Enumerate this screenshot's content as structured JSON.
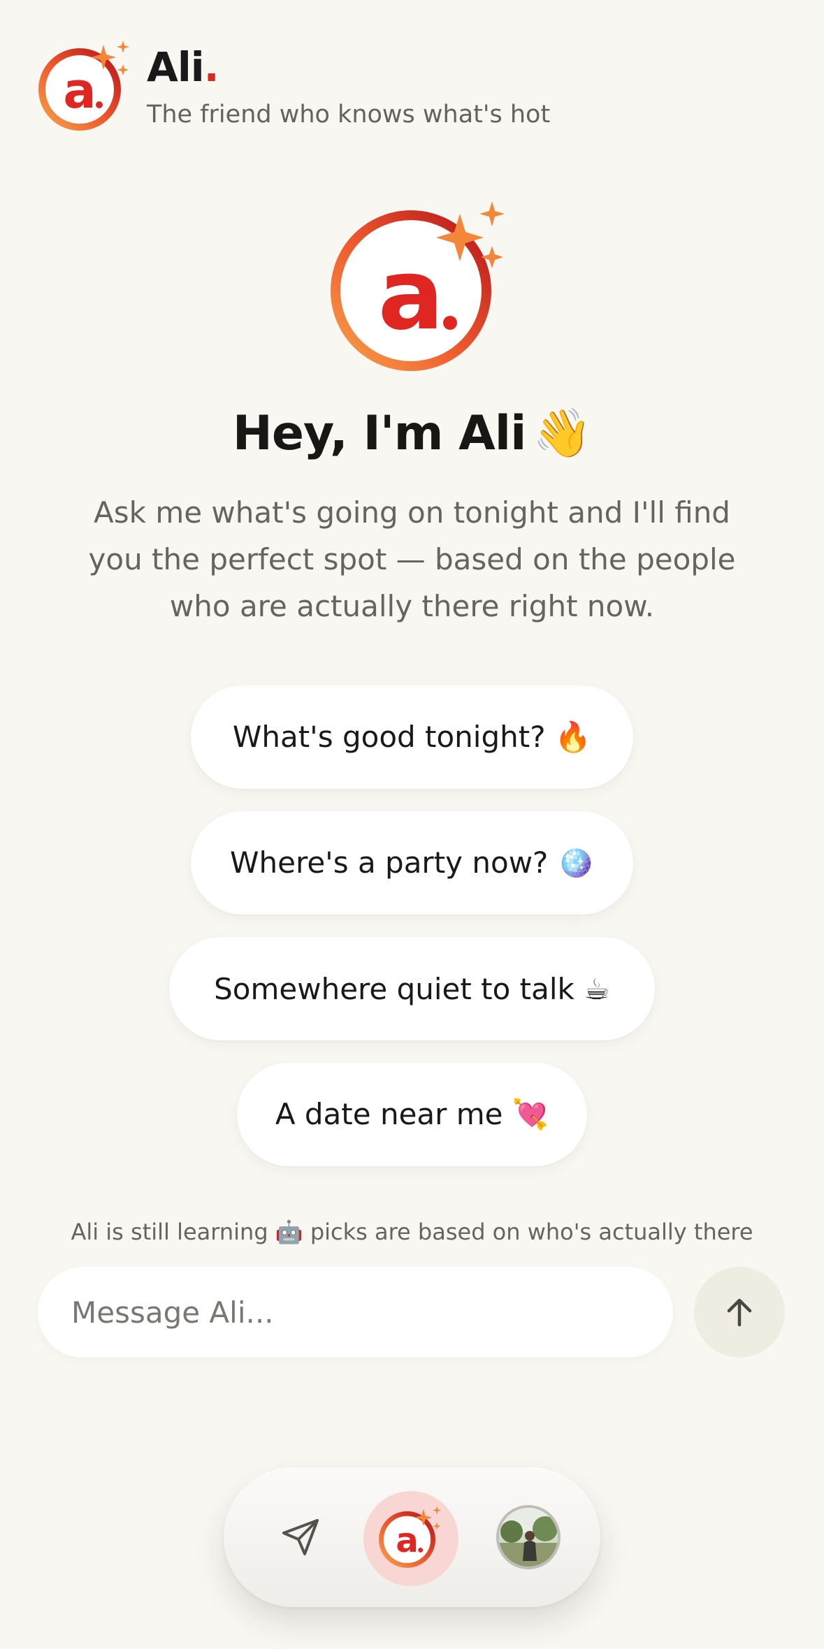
{
  "header": {
    "brand_name": "Ali",
    "brand_dot": ".",
    "tagline": "The friend who knows what's hot"
  },
  "hero": {
    "title": "Hey, I'm Ali",
    "title_emoji": "👋",
    "subtitle": "Ask me what's going on tonight and I'll find you the perfect spot — based on the people who are actually there right now."
  },
  "suggestions": [
    {
      "label": "What's good tonight? 🔥"
    },
    {
      "label": "Where's a party now? 🪩"
    },
    {
      "label": "Somewhere quiet to talk ☕"
    },
    {
      "label": "A date near me 💘"
    }
  ],
  "disclaimer": "Ali is still learning 🤖 picks are based on who's actually there",
  "composer": {
    "placeholder": "Message Ali...",
    "send_icon": "arrow-up-icon"
  },
  "nav": {
    "items": [
      {
        "name": "explore",
        "icon": "send-arrow-icon"
      },
      {
        "name": "ali",
        "icon": "ali-logo"
      },
      {
        "name": "profile",
        "icon": "profile-avatar"
      }
    ]
  },
  "logo": {
    "letter": "a",
    "dot": ".",
    "colors": {
      "red": "#e02621",
      "dark_red": "#c4161c",
      "orange": "#f47b3a",
      "sparkle": "#f4863a"
    }
  }
}
